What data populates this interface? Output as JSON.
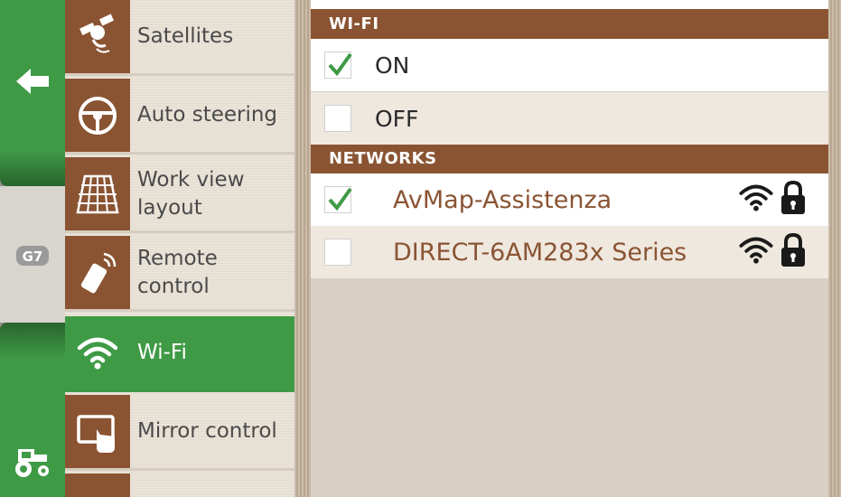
{
  "rail": {
    "back_icon": "back-arrow-icon",
    "brand_icon": "g7-logo-icon",
    "tractor_icon": "tractor-icon"
  },
  "menu": {
    "items": [
      {
        "label": "Satellites",
        "icon": "satellite-icon",
        "active": false
      },
      {
        "label": "Auto steering",
        "icon": "steering-wheel-icon",
        "active": false
      },
      {
        "label": "Work view layout",
        "icon": "work-view-grid-icon",
        "active": false
      },
      {
        "label": "Remote control",
        "icon": "remote-control-icon",
        "active": false
      },
      {
        "label": "Wi-Fi",
        "icon": "wifi-icon",
        "active": true
      },
      {
        "label": "Mirror control",
        "icon": "mirror-touch-icon",
        "active": false
      }
    ]
  },
  "wifi": {
    "header": "WI-FI",
    "options": [
      {
        "label": "ON",
        "checked": true
      },
      {
        "label": "OFF",
        "checked": false
      }
    ]
  },
  "networks": {
    "header": "NETWORKS",
    "items": [
      {
        "ssid": "AvMap-Assistenza",
        "checked": true,
        "signal_icon": "wifi-signal-icon",
        "lock_icon": "lock-icon"
      },
      {
        "ssid": "DIRECT-6AM283x Series",
        "checked": false,
        "signal_icon": "wifi-signal-icon",
        "lock_icon": "lock-icon"
      }
    ]
  },
  "colors": {
    "green": "#3f9a46",
    "brown": "#8a5433",
    "beige": "#efe8df",
    "panel": "#d9cfc3"
  }
}
